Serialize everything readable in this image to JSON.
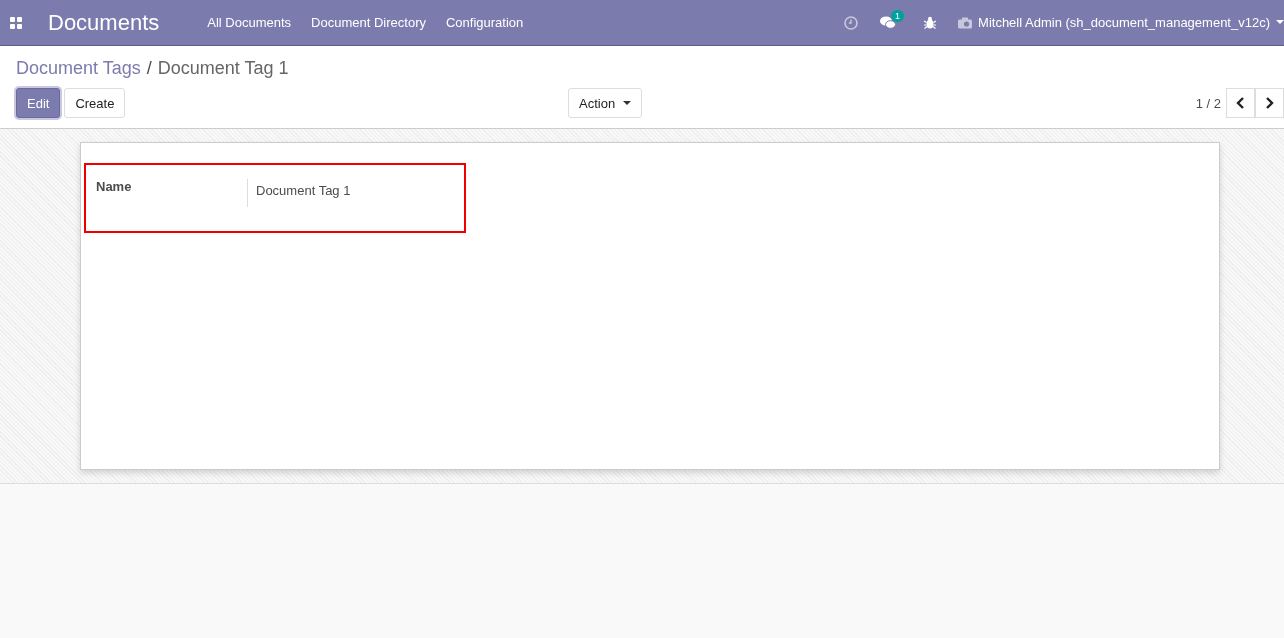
{
  "navbar": {
    "app_title": "Documents",
    "menu": [
      "All Documents",
      "Document Directory",
      "Configuration"
    ],
    "messages_badge": "1",
    "user": "Mitchell Admin (sh_document_management_v12c)"
  },
  "breadcrumb": {
    "parent": "Document Tags",
    "separator": "/",
    "current": "Document Tag 1"
  },
  "buttons": {
    "edit": "Edit",
    "create": "Create",
    "action": "Action"
  },
  "pager": {
    "value": "1 / 2"
  },
  "form": {
    "fields": [
      {
        "label": "Name",
        "value": "Document Tag 1"
      }
    ]
  }
}
